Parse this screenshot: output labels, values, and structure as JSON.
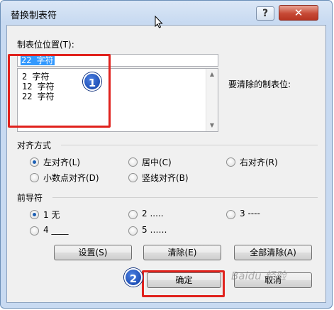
{
  "window": {
    "title": "替换制表符",
    "help_glyph": "?",
    "close_glyph": "✕"
  },
  "tab_position": {
    "label": "制表位位置(T):",
    "input_value": "22 字符",
    "list_items": [
      "2 字符",
      "12 字符",
      "22 字符"
    ]
  },
  "to_clear_label": "要清除的制表位:",
  "alignment": {
    "label": "对齐方式",
    "options": [
      "左对齐(L)",
      "居中(C)",
      "右对齐(R)",
      "小数点对齐(D)",
      "竖线对齐(B)"
    ],
    "selected": "左对齐(L)"
  },
  "leader": {
    "label": "前导符",
    "options": [
      "1 无",
      "2 .....",
      "3 ----",
      "4 ____",
      "5 ……"
    ],
    "selected": "1 无"
  },
  "buttons": {
    "set": "设置(S)",
    "clear": "清除(E)",
    "clear_all": "全部清除(A)",
    "ok": "确定",
    "cancel": "取消"
  },
  "badges": {
    "one": "1",
    "two": "2"
  },
  "watermark": "Baidu 经验",
  "colors": {
    "annotation_red": "#e0221d",
    "badge_blue": "#1a4fc4",
    "selection_blue": "#3399ff"
  }
}
